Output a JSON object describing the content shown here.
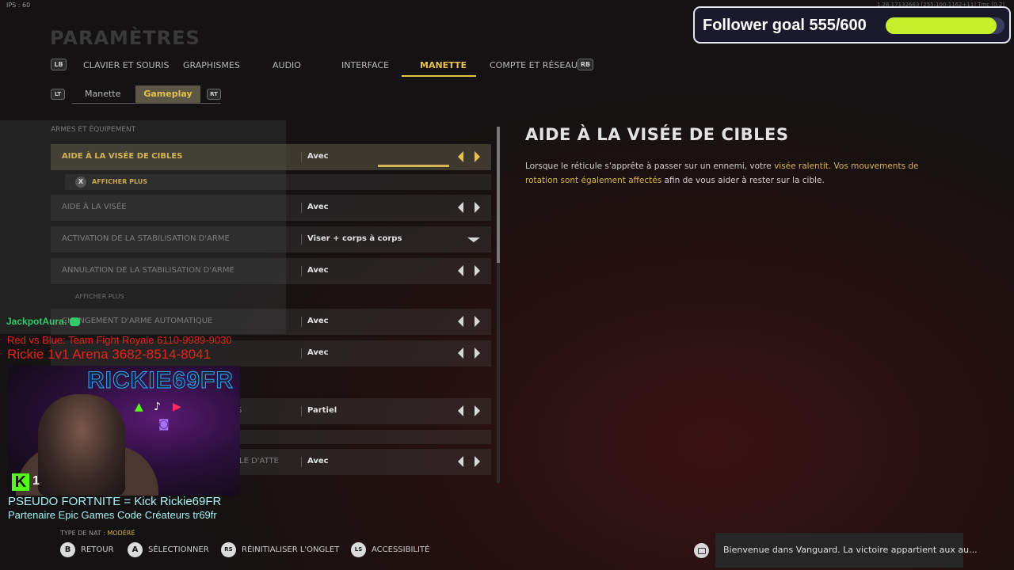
{
  "hud": {
    "fps_label": "IPS : 60",
    "build": "1.26.17132663 [255:100:1162+11] Tmc [0.2]"
  },
  "page": {
    "title": "PARAMÈTRES"
  },
  "tabs": {
    "prev_hint": "LB",
    "next_hint": "RB",
    "items": [
      "CLAVIER ET SOURIS",
      "GRAPHISMES",
      "AUDIO",
      "INTERFACE",
      "MANETTE",
      "COMPTE ET RÉSEAU"
    ],
    "active": "MANETTE"
  },
  "subtabs": {
    "prev_hint": "LT",
    "next_hint": "RT",
    "items": [
      "Manette",
      "Gameplay"
    ],
    "active": "Gameplay"
  },
  "settings": {
    "section": "ARMES ET ÉQUIPEMENT",
    "show_more": "AFFICHER PLUS",
    "show_more_button": "X",
    "rows": [
      {
        "label": "AIDE À LA VISÉE DE CIBLES",
        "value": "Avec"
      },
      {
        "label": "AIDE À LA VISÉE",
        "value": "Avec"
      },
      {
        "label": "ACTIVATION DE LA STABILISATION D'ARME",
        "value": "Viser + corps à corps"
      },
      {
        "label": "ANNULATION DE LA STABILISATION D'ARME",
        "value": "Avec"
      },
      {
        "label": "CHANGEMENT D'ARME AUTOMATIQUE",
        "value": "Avec"
      },
      {
        "label": "",
        "value": "Avec"
      },
      {
        "label": "RS",
        "value": "Partiel"
      },
      {
        "label": "LE D'ATTE",
        "value": "Avec"
      }
    ]
  },
  "detail": {
    "title": "AIDE À LA VISÉE DE CIBLES",
    "text_1": "Lorsque le réticule s'apprête à passer sur un ennemi, votre ",
    "hl_1": "visée ralentit. Vos mouvements de rotation sont également affectés",
    "text_2": " afin de vous aider à rester sur la cible."
  },
  "overlay": {
    "goal_text": "Follower goal 555/600",
    "goal_progress": 0.925,
    "goal_fill_color": "#c6f02a",
    "channel_neon": "RICKIE69FR",
    "kick_badge": "K",
    "viewer_count": "1",
    "chat_user": "JackpotAura:",
    "line_red_1": "Red vs Blue: Team Fight Royale 6110-9989-9030",
    "line_red_2": "Rickie 1v1 Arena 3682-8514-8041",
    "line_cyan_1": "PSEUDO FORTNITE = Kick Rickie69FR",
    "line_cyan_2": "Partenaire Epic Games Code Créateurs tr69fr"
  },
  "nat": {
    "label": "TYPE DE NAT : ",
    "value": "MODÉRÉ"
  },
  "footer": {
    "back": {
      "key": "B",
      "label": "RETOUR"
    },
    "select": {
      "key": "A",
      "label": "SÉLECTIONNER"
    },
    "reset": {
      "key": "RS",
      "label": "RÉINITIALISER L'ONGLET"
    },
    "accessibility": {
      "key": "LS",
      "label": "ACCESSIBILITÉ"
    }
  },
  "notification": {
    "text": "Bienvenue dans Vanguard. La victoire appartient aux au..."
  }
}
